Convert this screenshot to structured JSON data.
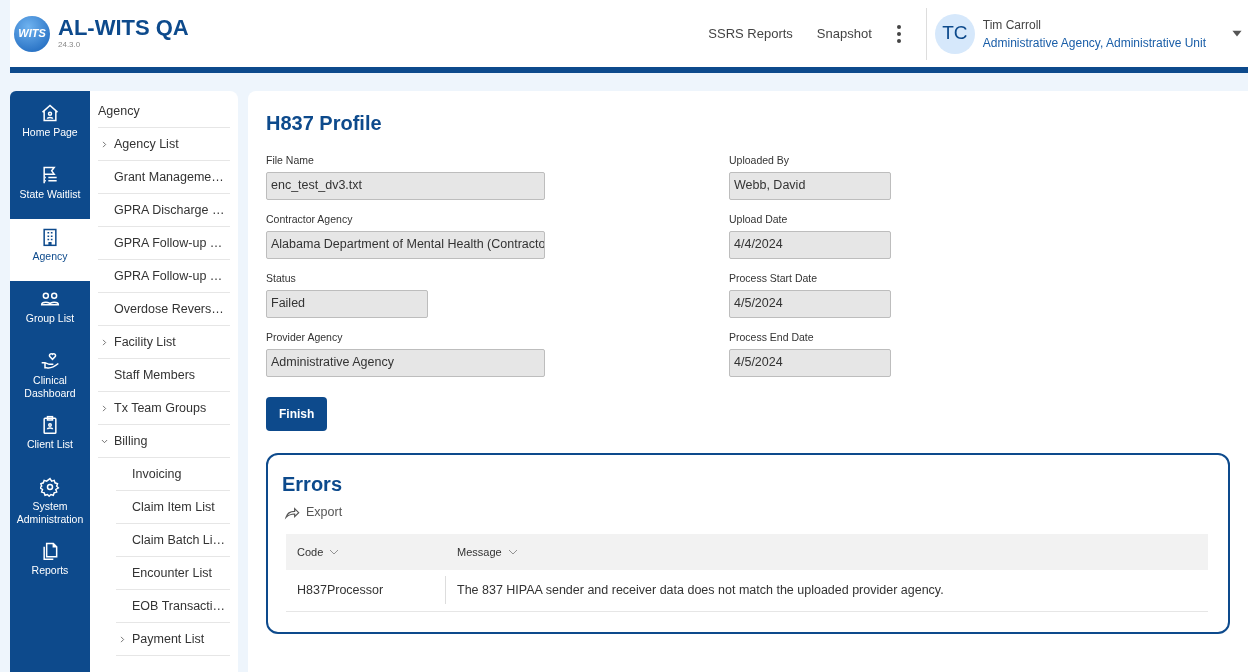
{
  "app": {
    "title": "AL-WITS QA",
    "version": "24.3.0",
    "logo_text": "WITS"
  },
  "header": {
    "links": [
      "SSRS Reports",
      "Snapshot"
    ],
    "user": {
      "initials": "TC",
      "name": "Tim Carroll",
      "unit": "Administrative Agency, Administrative Unit"
    }
  },
  "nav": [
    {
      "label": "Home Page",
      "selected": false
    },
    {
      "label": "State Waitlist",
      "selected": false
    },
    {
      "label": "Agency",
      "selected": true
    },
    {
      "label": "Group List",
      "selected": false
    },
    {
      "label": "Clinical Dashboard",
      "selected": false
    },
    {
      "label": "Client List",
      "selected": false
    },
    {
      "label": "System Administration",
      "selected": false
    },
    {
      "label": "Reports",
      "selected": false
    }
  ],
  "submenu": {
    "title": "Agency",
    "items": [
      {
        "label": "Agency List",
        "expanded": false
      },
      {
        "label": "Grant Manageme…"
      },
      {
        "label": "GPRA Discharge …"
      },
      {
        "label": "GPRA Follow-up …"
      },
      {
        "label": "GPRA Follow-up …"
      },
      {
        "label": "Overdose Revers…"
      },
      {
        "label": "Facility List",
        "expanded": false
      },
      {
        "label": "Staff Members"
      },
      {
        "label": "Tx Team Groups",
        "expanded": false
      },
      {
        "label": "Billing",
        "expanded": true,
        "children": [
          {
            "label": "Invoicing"
          },
          {
            "label": "Claim Item List"
          },
          {
            "label": "Claim Batch Li…"
          },
          {
            "label": "Encounter List"
          },
          {
            "label": "EOB Transacti…"
          },
          {
            "label": "Payment List",
            "expanded": false
          }
        ]
      }
    ]
  },
  "page": {
    "title": "H837 Profile",
    "fields_left": [
      {
        "label": "File Name",
        "value": "enc_test_dv3.txt",
        "kind": "wide"
      },
      {
        "label": "Contractor Agency",
        "value": "Alabama Department of Mental Health (Contracto",
        "kind": "wide"
      },
      {
        "label": "Status",
        "value": "Failed",
        "kind": "narrow"
      },
      {
        "label": "Provider Agency",
        "value": "Administrative Agency",
        "kind": "wide"
      }
    ],
    "fields_right": [
      {
        "label": "Uploaded By",
        "value": "Webb, David",
        "kind": "narrow"
      },
      {
        "label": "Upload Date",
        "value": "4/4/2024",
        "kind": "narrow"
      },
      {
        "label": "Process Start Date",
        "value": "4/5/2024",
        "kind": "narrow"
      },
      {
        "label": "Process End Date",
        "value": "4/5/2024",
        "kind": "narrow"
      }
    ],
    "button": "Finish",
    "errors": {
      "title": "Errors",
      "export": "Export",
      "columns": [
        "Code",
        "Message"
      ],
      "rows": [
        [
          "H837Processor",
          "The 837 HIPAA sender and receiver data does not match the uploaded provider agency."
        ]
      ]
    }
  }
}
